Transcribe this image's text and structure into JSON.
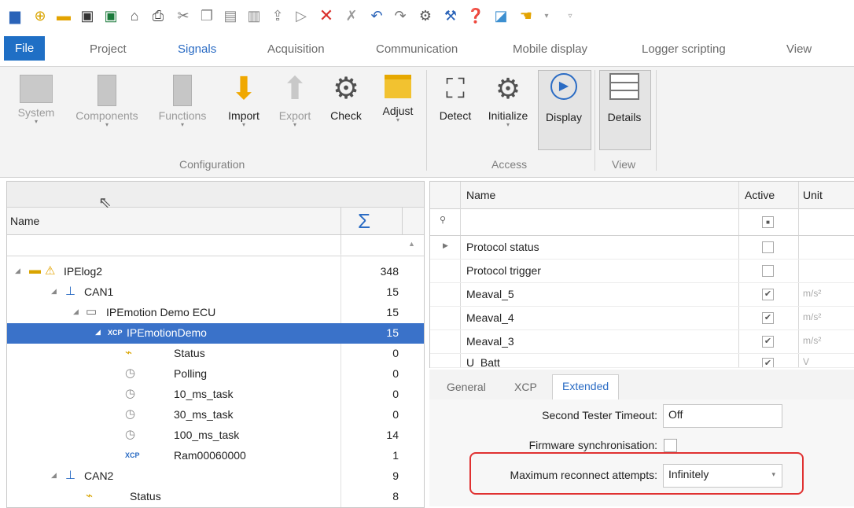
{
  "quick_access": {
    "icons": [
      "app-icon",
      "new-icon",
      "open-icon",
      "save-icon",
      "save-as-icon",
      "auto-icon",
      "print-icon",
      "cut-icon",
      "copy-icon",
      "paste-icon",
      "paste-special-icon",
      "import-icon",
      "export-icon",
      "delete-icon",
      "delete-all-icon",
      "undo-icon",
      "redo-icon",
      "settings-icon",
      "tools-icon",
      "help-icon",
      "chart-icon",
      "hand-icon",
      "more-icon"
    ]
  },
  "ribbon_tabs": [
    "File",
    "Project",
    "Signals",
    "Acquisition",
    "Communication",
    "Mobile display",
    "Logger scripting",
    "View"
  ],
  "ribbon": {
    "buttons": {
      "system": "System",
      "components": "Components",
      "functions": "Functions",
      "import": "Import",
      "export": "Export",
      "check": "Check",
      "adjust": "Adjust",
      "detect": "Detect",
      "initialize": "Initialize",
      "display": "Display",
      "details": "Details"
    },
    "groups": {
      "configuration": "Configuration",
      "access": "Access",
      "view": "View"
    }
  },
  "tree": {
    "header_name": "Name",
    "header_sum": "Σ",
    "rows": [
      {
        "label": "IPElog2",
        "count": "348"
      },
      {
        "label": "CAN1",
        "count": "15"
      },
      {
        "label": "IPEmotion Demo ECU",
        "count": "15"
      },
      {
        "label": "IPEmotionDemo",
        "count": "15"
      },
      {
        "label": "Status",
        "count": "0"
      },
      {
        "label": "Polling",
        "count": "0"
      },
      {
        "label": "10_ms_task",
        "count": "0"
      },
      {
        "label": "30_ms_task",
        "count": "0"
      },
      {
        "label": "100_ms_task",
        "count": "14"
      },
      {
        "label": "Ram00060000",
        "count": "1"
      },
      {
        "label": "CAN2",
        "count": "9"
      },
      {
        "label": "Status",
        "count": "8"
      }
    ],
    "xcp_badge": "XCP"
  },
  "grid": {
    "columns": {
      "name": "Name",
      "active": "Active",
      "unit": "Unit"
    },
    "rows": [
      {
        "name": "Protocol status",
        "active": "",
        "unit": ""
      },
      {
        "name": "Protocol trigger",
        "active": "",
        "unit": ""
      },
      {
        "name": "Meaval_5",
        "active": "✔",
        "unit": "m/s²"
      },
      {
        "name": "Meaval_4",
        "active": "✔",
        "unit": "m/s²"
      },
      {
        "name": "Meaval_3",
        "active": "✔",
        "unit": "m/s²"
      },
      {
        "name": "U_Batt",
        "active": "✔",
        "unit": "V"
      }
    ]
  },
  "prop_tabs": [
    "General",
    "XCP",
    "Extended"
  ],
  "props": {
    "second_tester_timeout_label": "Second Tester Timeout:",
    "second_tester_timeout_value": "Off",
    "firmware_sync_label": "Firmware synchronisation:",
    "max_reconnect_label": "Maximum reconnect attempts:",
    "max_reconnect_value": "Infinitely"
  },
  "colors": {
    "accent": "#2b6cc4",
    "file_tab": "#1f6fc5",
    "selection": "#3a72c9",
    "highlight": "#e03131"
  }
}
